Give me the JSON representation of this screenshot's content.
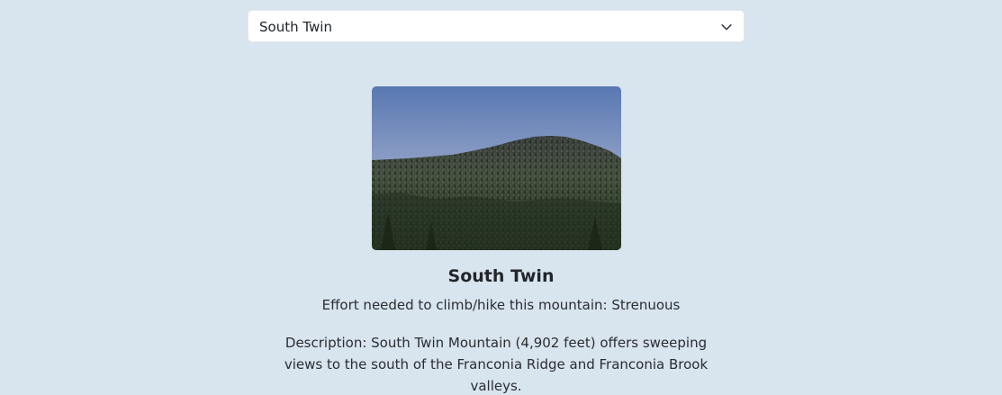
{
  "selector": {
    "selected": "South Twin",
    "icon": "chevron-down-icon"
  },
  "mountain": {
    "name": "South Twin",
    "effort_prefix": "Effort needed to climb/hike this mountain: ",
    "effort": "Strenuous",
    "effort_text": "Effort needed to climb/hike this mountain: Strenuous",
    "description": "Description: South Twin Mountain (4,902 feet) offers sweeping views to the south of the Franconia Ridge and Franconia Brook valleys."
  },
  "colors": {
    "background": "#d8e4ee",
    "card": "#ffffff",
    "text": "#2a2d31",
    "sky_top": "#5b7db5",
    "forest": "#2c3628"
  }
}
